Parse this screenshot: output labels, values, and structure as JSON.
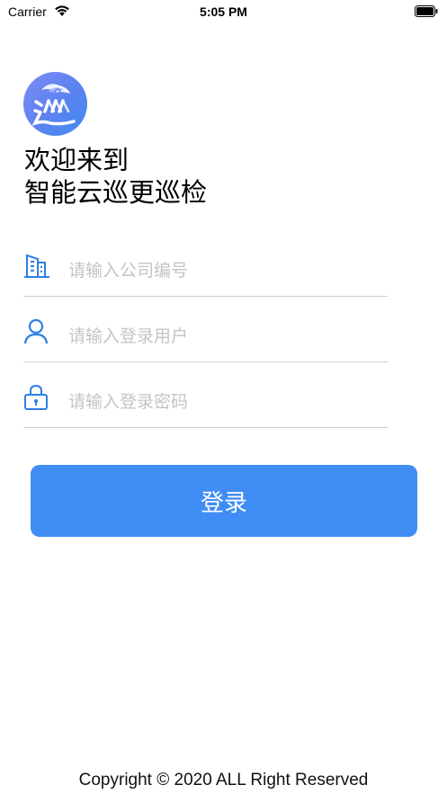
{
  "status_bar": {
    "carrier": "Carrier",
    "time": "5:05 PM",
    "icons": [
      "wifi-icon",
      "battery-icon"
    ]
  },
  "logo": {
    "icon": "patrol-logo-icon"
  },
  "welcome": {
    "line1": "欢迎来到",
    "line2": "智能云巡更巡检"
  },
  "form": {
    "company": {
      "placeholder": "请输入公司编号",
      "value": "",
      "icon": "building-icon"
    },
    "username": {
      "placeholder": "请输入登录用户",
      "value": "",
      "icon": "user-icon"
    },
    "password": {
      "placeholder": "请输入登录密码",
      "value": "",
      "icon": "lock-icon"
    }
  },
  "login_button": {
    "label": "登录"
  },
  "footer": {
    "copyright": "Copyright © 2020 ALL Right Reserved"
  },
  "colors": {
    "accent": "#3f8df5",
    "icon_blue": "#2f7fe6",
    "divider": "#cfcfcf",
    "placeholder": "#c4c4c4"
  }
}
